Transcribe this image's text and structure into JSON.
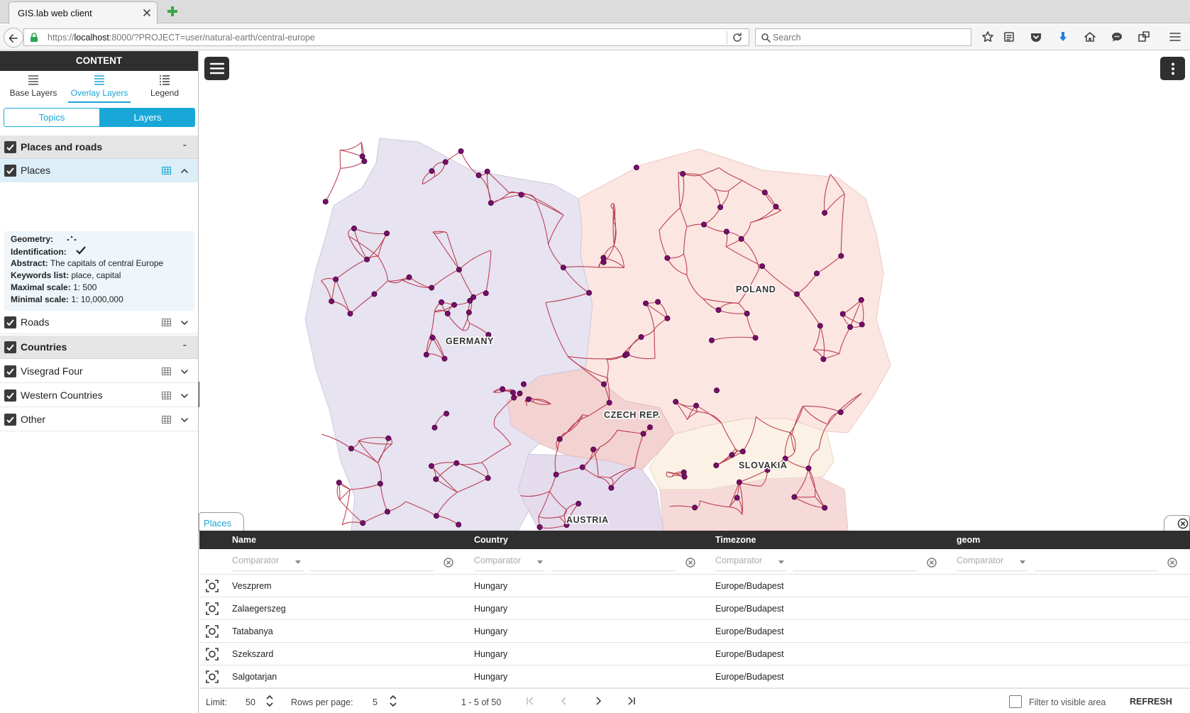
{
  "browser": {
    "tab_title": "GIS.lab web client",
    "url_prefix": "https://",
    "url_host": "localhost",
    "url_rest": ":8000/?PROJECT=user/natural-earth/central-europe",
    "search_placeholder": "Search"
  },
  "panel": {
    "header": "CONTENT",
    "tabs": [
      {
        "label": "Base Layers",
        "icon": "base-layers-icon"
      },
      {
        "label": "Overlay Layers",
        "icon": "overlay-layers-icon",
        "active": true
      },
      {
        "label": "Legend",
        "icon": "legend-icon"
      }
    ],
    "segment": {
      "topics": "Topics",
      "layers": "Layers",
      "selected": "Layers"
    },
    "groups": [
      {
        "label": "Places and roads",
        "checked": true,
        "collapse_symbol": "-",
        "layers": [
          {
            "label": "Places",
            "checked": true,
            "expanded": true
          },
          {
            "label": "Roads",
            "checked": true,
            "expanded": false
          }
        ]
      },
      {
        "label": "Countries",
        "checked": true,
        "collapse_symbol": "-",
        "layers": [
          {
            "label": "Visegrad Four",
            "checked": true
          },
          {
            "label": "Western Countries",
            "checked": true
          },
          {
            "label": "Other",
            "checked": true
          }
        ]
      }
    ],
    "places_detail": {
      "geometry_label": "Geometry:",
      "identification_label": "Identification:",
      "abstract_label": "Abstract:",
      "abstract_value": "The capitals of central Europe",
      "keywords_label": "Keywords list:",
      "keywords_value": "place, capital",
      "max_scale_label": "Maximal scale:",
      "max_scale_value": "1: 500",
      "min_scale_label": "Minimal scale:",
      "min_scale_value": "1: 10,000,000"
    }
  },
  "map": {
    "country_labels": [
      "GERMANY",
      "POLAND",
      "CZECH REP.",
      "SLOVAKIA",
      "AUSTRIA"
    ],
    "colors": {
      "germany": "#e7e3f0",
      "poland": "#fbe6e2",
      "czech": "#f3d2d2",
      "slovakia": "#fbf1e4",
      "austria": "#e4dcec",
      "roads": "#b3243a",
      "places": "#7a0d6b"
    }
  },
  "attribute_table": {
    "tab_label": "Places",
    "columns": [
      "Name",
      "Country",
      "Timezone",
      "geom"
    ],
    "comparator_placeholder": "Comparator",
    "rows": [
      {
        "name": "Veszprem",
        "country": "Hungary",
        "timezone": "Europe/Budapest"
      },
      {
        "name": "Zalaegerszeg",
        "country": "Hungary",
        "timezone": "Europe/Budapest"
      },
      {
        "name": "Tatabanya",
        "country": "Hungary",
        "timezone": "Europe/Budapest"
      },
      {
        "name": "Szekszard",
        "country": "Hungary",
        "timezone": "Europe/Budapest"
      },
      {
        "name": "Salgotarjan",
        "country": "Hungary",
        "timezone": "Europe/Budapest"
      }
    ],
    "footer": {
      "limit_label": "Limit:",
      "limit_value": "50",
      "rows_per_page_label": "Rows per page:",
      "rows_per_page_value": "5",
      "range": "1 - 5 of 50",
      "filter_visible_label": "Filter to visible area",
      "refresh_label": "REFRESH"
    }
  }
}
